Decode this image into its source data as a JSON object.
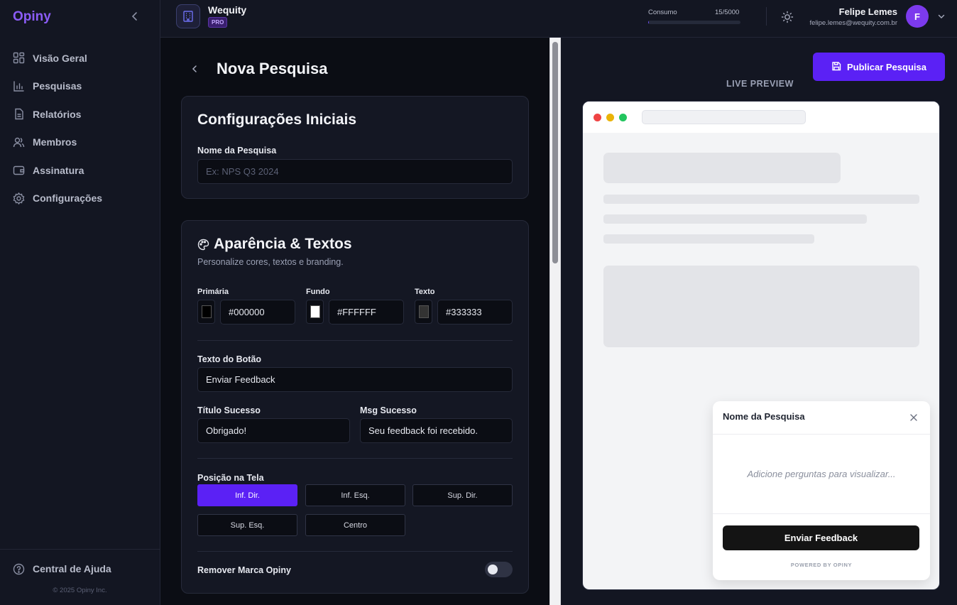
{
  "sidebar": {
    "brand": "Opiny",
    "items": [
      {
        "label": "Visão Geral",
        "icon": "grid-icon"
      },
      {
        "label": "Pesquisas",
        "icon": "bar-chart-icon"
      },
      {
        "label": "Relatórios",
        "icon": "report-icon"
      },
      {
        "label": "Membros",
        "icon": "users-icon"
      },
      {
        "label": "Assinatura",
        "icon": "wallet-icon"
      },
      {
        "label": "Configurações",
        "icon": "gear-icon"
      }
    ],
    "help_label": "Central de Ajuda",
    "copyright": "© 2025 Opiny Inc."
  },
  "header": {
    "org_name": "Wequity",
    "plan_badge": "PRO",
    "consumo_label": "Consumo",
    "consumo_value": "15/5000",
    "consumo_fraction": 0.003,
    "user_name": "Felipe Lemes",
    "user_email": "felipe.lemes@wequity.com.br",
    "avatar_initial": "F"
  },
  "editor": {
    "page_title": "Nova Pesquisa",
    "initial_settings": {
      "title": "Configurações Iniciais",
      "name_label": "Nome da Pesquisa",
      "name_placeholder": "Ex: NPS Q3 2024"
    },
    "appearance": {
      "title": "Aparência & Textos",
      "subtitle": "Personalize cores, textos e branding.",
      "colors": [
        {
          "label": "Primária",
          "value": "#000000",
          "swatch": "#000000"
        },
        {
          "label": "Fundo",
          "value": "#FFFFFF",
          "swatch": "#FFFFFF"
        },
        {
          "label": "Texto",
          "value": "#333333",
          "swatch": "#333333"
        }
      ],
      "button_text_label": "Texto do Botão",
      "button_text_value": "Enviar Feedback",
      "success_title_label": "Título Sucesso",
      "success_title_value": "Obrigado!",
      "success_msg_label": "Msg Sucesso",
      "success_msg_value": "Seu feedback foi recebido.",
      "position_label": "Posição na Tela",
      "positions": [
        "Inf. Dir.",
        "Inf. Esq.",
        "Sup. Dir.",
        "Sup. Esq.",
        "Centro"
      ],
      "selected_position": "Inf. Dir.",
      "remove_brand_label": "Remover Marca Opiny",
      "remove_brand_enabled": false
    }
  },
  "preview": {
    "publish_label": "Publicar Pesquisa",
    "live_label": "LIVE PREVIEW",
    "widget_title": "Nome da Pesquisa",
    "widget_empty": "Adicione perguntas para visualizar...",
    "widget_button": "Enviar Feedback",
    "powered_by": "POWERED BY OPINY"
  },
  "colors": {
    "accent": "#5b21f5",
    "brand": "#8b5cf6",
    "background": "#0b0d14",
    "panel": "#141723"
  }
}
